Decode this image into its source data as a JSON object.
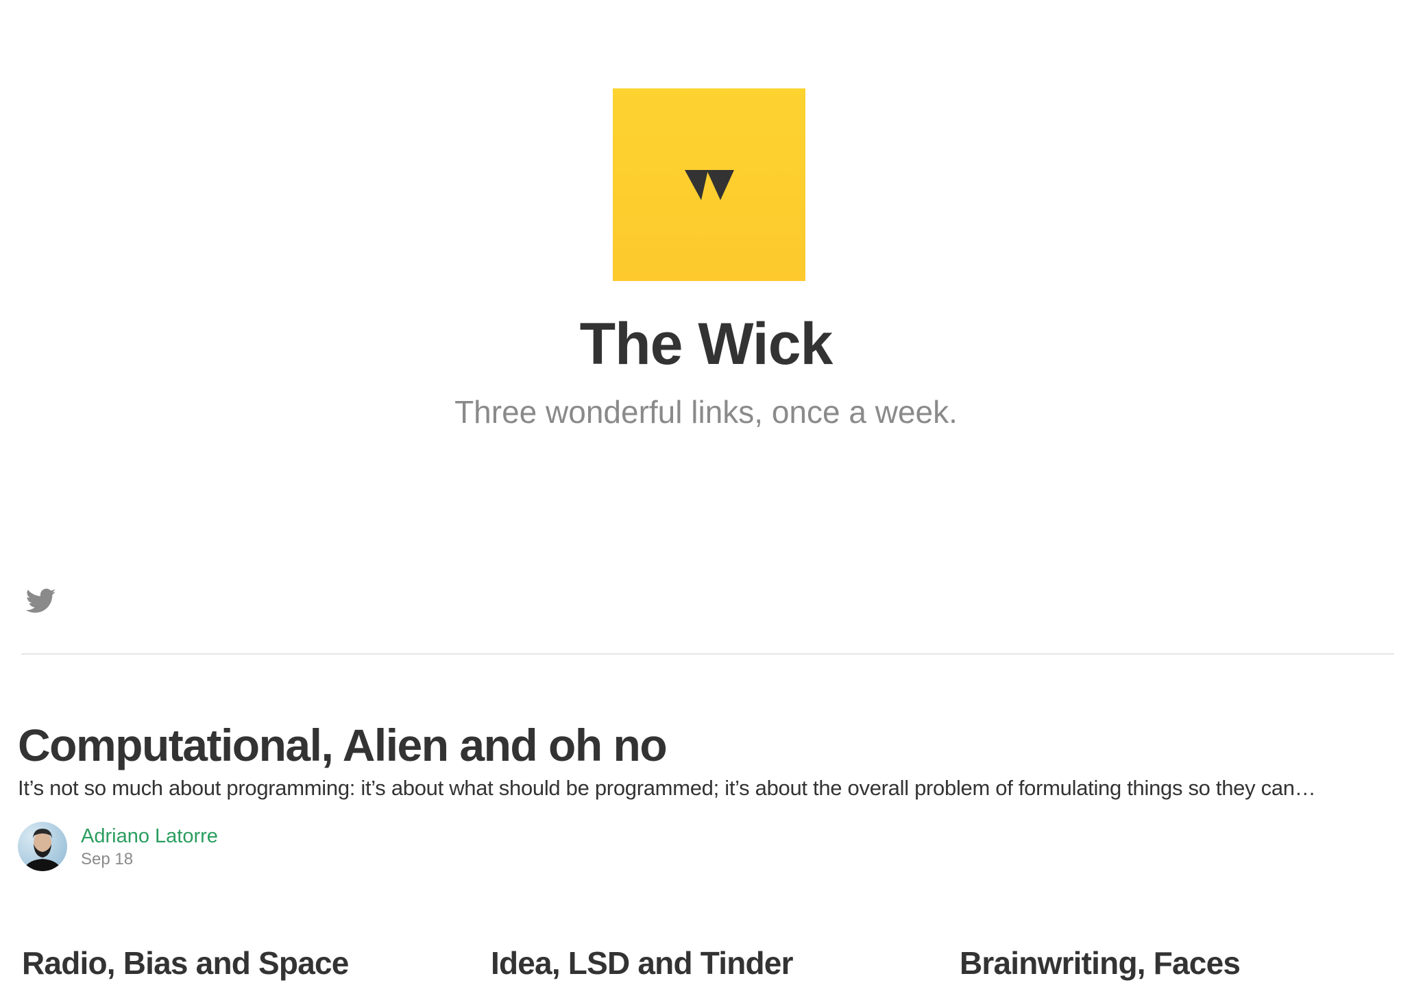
{
  "publication": {
    "title": "The Wick",
    "tagline": "Three wonderful links, once a week.",
    "logo_icon": "wick-w-logo",
    "logo_color": "#fdd330"
  },
  "social": {
    "twitter_icon": "twitter-bird-icon"
  },
  "featured_post": {
    "title": "Computational, Alien and oh no",
    "excerpt": "It’s not so much about programming: it’s about what should be programmed; it’s about the overall problem of formulating things so they can…",
    "author": "Adriano Latorre",
    "date": "Sep 18",
    "author_color": "#2a9d5f"
  },
  "post_cards": [
    {
      "title": "Radio, Bias and Space"
    },
    {
      "title": "Idea, LSD and Tinder"
    },
    {
      "title": "Brainwriting, Faces"
    }
  ]
}
